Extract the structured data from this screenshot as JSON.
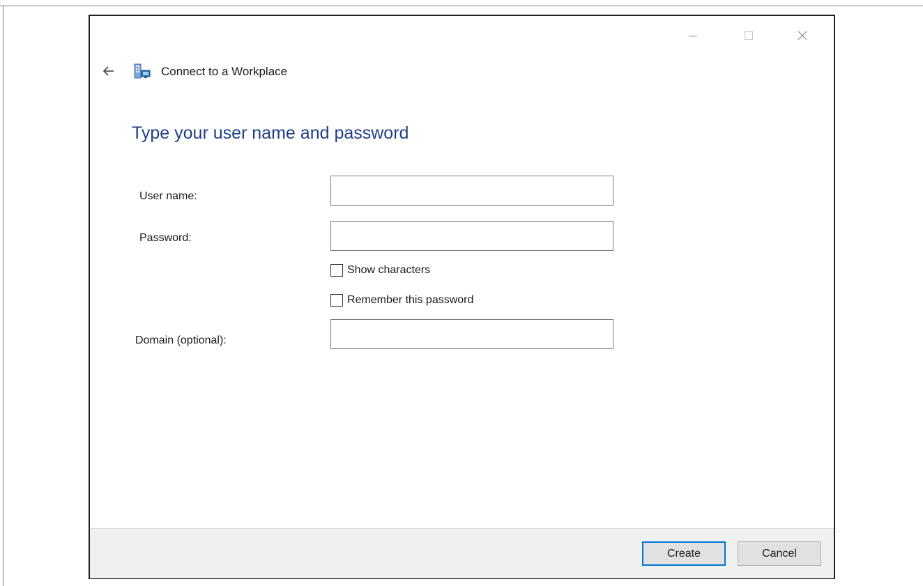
{
  "window": {
    "title": "Connect to a Workplace"
  },
  "form": {
    "heading": "Type your user name and password",
    "username_label": "User name:",
    "username_value": "",
    "password_label": "Password:",
    "password_value": "",
    "show_characters_label": "Show characters",
    "show_characters_checked": false,
    "remember_password_label": "Remember this password",
    "remember_password_checked": false,
    "domain_label": "Domain (optional):",
    "domain_value": ""
  },
  "footer": {
    "create_label": "Create",
    "cancel_label": "Cancel"
  },
  "icons": {
    "back": "back-arrow-icon",
    "app": "workplace-network-icon",
    "minimize": "minimize-icon",
    "maximize": "maximize-icon",
    "close": "close-icon"
  },
  "colors": {
    "heading": "#1e3f87",
    "default_button_border": "#0078d7",
    "footer_bg": "#f0f0f0"
  }
}
